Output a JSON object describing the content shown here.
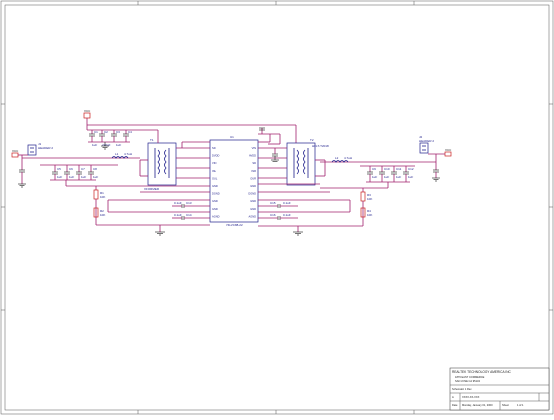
{
  "title_block": {
    "company": "REALTEK TECHNOLOGY AMERICA INC",
    "address_1": "1876 EAST COMMERCE",
    "address_2": "SAN JOSE CA 95134",
    "doc_title": "Schematic 1 Rev",
    "size_label": "A",
    "doc_number": "XXXX-XX-XXX",
    "date_label": "Date",
    "date_value": "Monday, January 01, 2000",
    "sheet_label": "Sheet",
    "sheet_value": "1 of 1"
  },
  "components": {
    "main_ic": {
      "ref": "U1",
      "part": "74LVC88-22"
    },
    "left_transformer": {
      "ref": "T1",
      "part": "XFORMER"
    },
    "right_transformer": {
      "ref": "T2",
      "part": "HFLT-T2018"
    },
    "left_connector": {
      "ref": "J1",
      "part": "HEADER 2"
    },
    "right_connector": {
      "ref": "J2",
      "part": "HEADER 2"
    },
    "left_inductor": {
      "ref": "L1",
      "part": "4.7uH"
    },
    "right_inductor": {
      "ref": "L2",
      "part": "4.7uH"
    },
    "vcc_left": "VCC",
    "vcc_right": "VCC",
    "vcc_top": "VCC"
  },
  "ic_pins_left": [
    "SD",
    "DVDD",
    "VIN",
    "INL",
    "OUL",
    "GND",
    "DGND",
    "GND",
    "GND",
    "AGND"
  ],
  "ic_pins_right": [
    "VIN",
    "AVDD",
    "SD",
    "INR",
    "OUR",
    "GND",
    "DGND",
    "GND",
    "GND",
    "AGND"
  ],
  "passive_labels": {
    "top_caps": [
      "C1",
      "C2",
      "C3",
      "C4"
    ],
    "top_cap_values": [
      "1uF",
      "220pF",
      "1uF"
    ],
    "left_caps": [
      "C5",
      "C6",
      "C7",
      "C8"
    ],
    "left_cap_values": [
      "1uF",
      "1uF",
      "1uF",
      "1uF"
    ],
    "right_caps": [
      "C9",
      "C10",
      "C11",
      "C12"
    ],
    "right_cap_values": [
      "1uF",
      "1uF",
      "1uF",
      "1uF"
    ],
    "resistors": [
      "R1",
      "R2",
      "R3",
      "R4"
    ],
    "resistor_values": [
      "10K",
      "10K",
      "10K",
      "10K"
    ],
    "mid_caps": [
      "C13",
      "C14",
      "C15",
      "C16"
    ],
    "mid_cap_values": [
      "0.1uF",
      "0.1uF",
      "0.1uF",
      "0.1uF"
    ]
  }
}
